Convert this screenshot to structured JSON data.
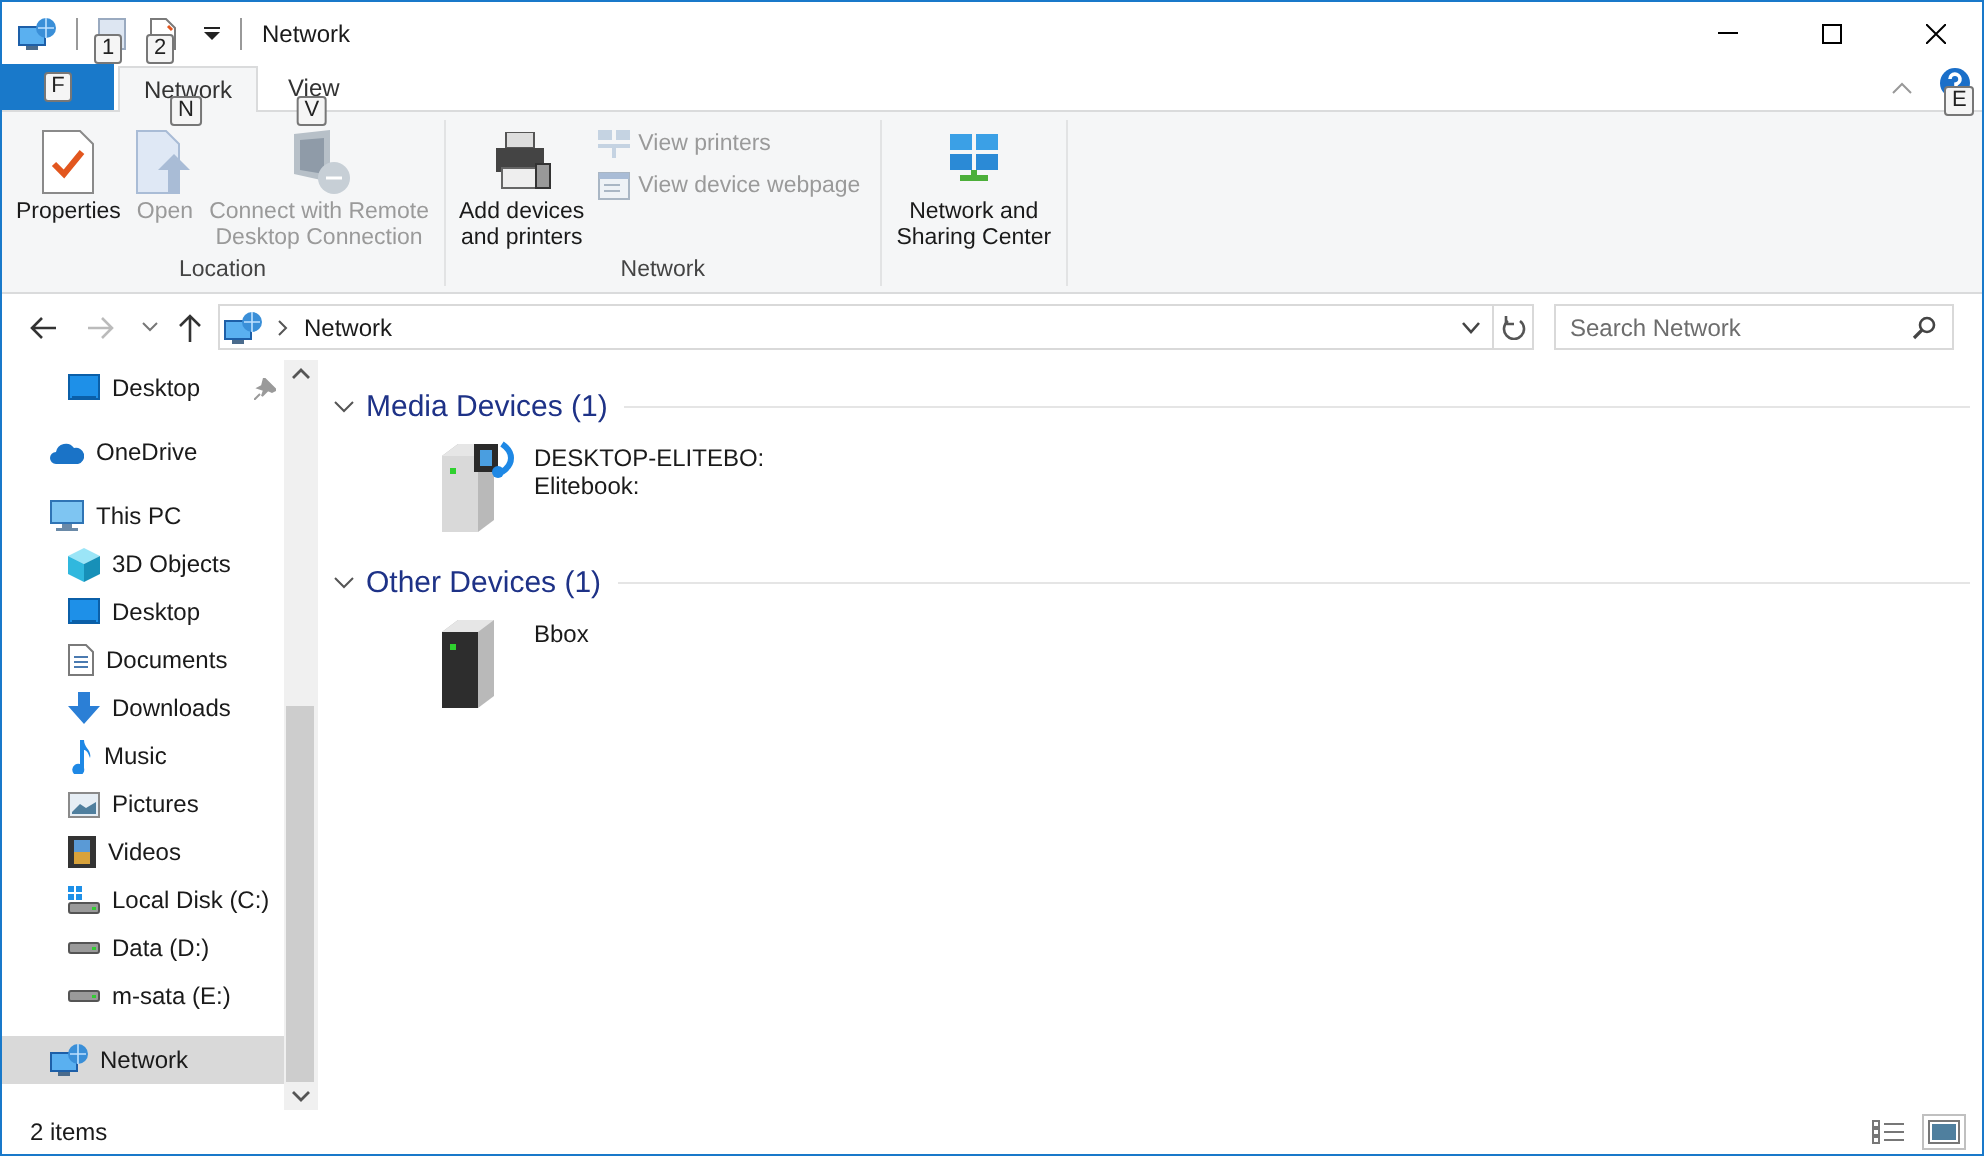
{
  "window": {
    "title": "Network"
  },
  "quick_access": [
    {
      "kind": "properties",
      "keytip": "1"
    },
    {
      "kind": "new-folder",
      "keytip": "2"
    }
  ],
  "ribbon": {
    "file_tab": {
      "keytip": "F"
    },
    "tabs": [
      {
        "label": "Network",
        "selected": true,
        "keytip": "N"
      },
      {
        "label": "View",
        "selected": false,
        "keytip": "V"
      }
    ],
    "help_keytip": "E",
    "groups": [
      {
        "label": "Location",
        "buttons": [
          {
            "label": "Properties",
            "kind": "properties",
            "disabled": false
          },
          {
            "label": "Open",
            "kind": "open",
            "disabled": true
          },
          {
            "label": "Connect with Remote\nDesktop Connection",
            "kind": "remote-desktop",
            "disabled": true
          }
        ]
      },
      {
        "label": "Network",
        "buttons": [
          {
            "label": "Add devices\nand printers",
            "kind": "printer",
            "disabled": false
          }
        ],
        "small_buttons": [
          {
            "label": "View printers",
            "kind": "view-printers",
            "disabled": true
          },
          {
            "label": "View device webpage",
            "kind": "webpage",
            "disabled": true
          }
        ]
      },
      {
        "buttons": [
          {
            "label": "Network and\nSharing Center",
            "kind": "sharing",
            "disabled": false
          }
        ]
      }
    ]
  },
  "navigation": {
    "back_disabled": false,
    "forward_disabled": true
  },
  "address": {
    "path": [
      "Network"
    ]
  },
  "search": {
    "placeholder": "Search Network"
  },
  "sidebar": {
    "items": [
      {
        "label": "Desktop",
        "kind": "desktop",
        "pinned": true,
        "selected": false
      },
      {
        "label": "OneDrive",
        "kind": "cloud",
        "pinned": false,
        "selected": false
      },
      {
        "label": "This PC",
        "kind": "pc",
        "pinned": false,
        "selected": false,
        "children": [
          {
            "label": "3D Objects",
            "kind": "cube",
            "pinned": false,
            "selected": false
          },
          {
            "label": "Desktop",
            "kind": "desktop",
            "pinned": false,
            "selected": false
          },
          {
            "label": "Documents",
            "kind": "document",
            "pinned": false,
            "selected": false
          },
          {
            "label": "Downloads",
            "kind": "download",
            "pinned": false,
            "selected": false
          },
          {
            "label": "Music",
            "kind": "music",
            "pinned": false,
            "selected": false
          },
          {
            "label": "Pictures",
            "kind": "pictures",
            "pinned": false,
            "selected": false
          },
          {
            "label": "Videos",
            "kind": "videos",
            "pinned": false,
            "selected": false
          },
          {
            "label": "Local Disk (C:)",
            "kind": "system-disk",
            "pinned": false,
            "selected": false
          },
          {
            "label": "Data (D:)",
            "kind": "disk",
            "pinned": false,
            "selected": false
          },
          {
            "label": "m-sata (E:)",
            "kind": "disk",
            "pinned": false,
            "selected": false
          }
        ]
      },
      {
        "label": "Network",
        "kind": "network",
        "pinned": false,
        "selected": true
      }
    ]
  },
  "groups": [
    {
      "title": "Media Devices (1)",
      "expanded": true,
      "items": [
        {
          "kind": "media-server",
          "lines": [
            "DESKTOP-ELITEBO:",
            "Elitebook:"
          ]
        }
      ]
    },
    {
      "title": "Other Devices (1)",
      "expanded": true,
      "items": [
        {
          "kind": "device",
          "lines": [
            "Bbox"
          ]
        }
      ]
    }
  ],
  "status_bar": {
    "text": "2 items",
    "views": [
      {
        "kind": "details",
        "selected": false
      },
      {
        "kind": "large-icons",
        "selected": true
      }
    ]
  }
}
